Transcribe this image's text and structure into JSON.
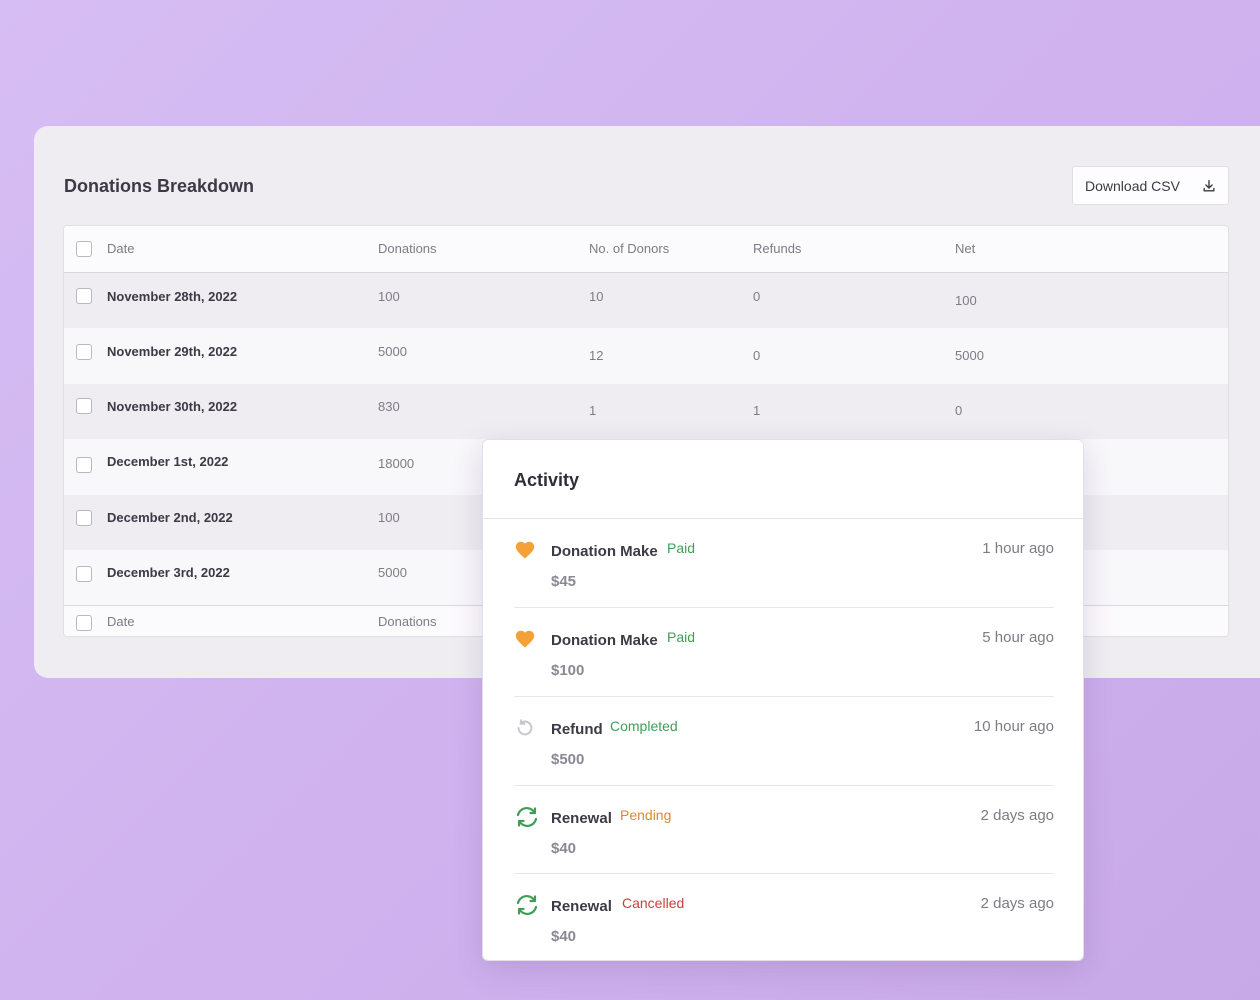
{
  "breakdown": {
    "title": "Donations Breakdown",
    "download_label": "Download CSV",
    "columns": [
      "Date",
      "Donations",
      "No. of Donors",
      "Refunds",
      "Net"
    ],
    "rows": [
      {
        "date": "November 28th, 2022",
        "donations": "100",
        "donors": "10",
        "refunds": "0",
        "net": "100"
      },
      {
        "date": "November 29th, 2022",
        "donations": "5000",
        "donors": "12",
        "refunds": "0",
        "net": "5000"
      },
      {
        "date": "November 30th, 2022",
        "donations": "830",
        "donors": "1",
        "refunds": "1",
        "net": "0"
      },
      {
        "date": "December 1st, 2022",
        "donations": "18000"
      },
      {
        "date": "December 2nd, 2022",
        "donations": "100"
      },
      {
        "date": "December 3rd, 2022",
        "donations": "5000"
      }
    ],
    "footer": {
      "date": "Date",
      "donations": "Donations"
    }
  },
  "activity": {
    "title": "Activity",
    "items": [
      {
        "icon": "heart-icon",
        "name": "Donation Make",
        "status": "Paid",
        "status_color": "#3f9e58",
        "amount": "$45",
        "time": "1 hour ago"
      },
      {
        "icon": "heart-icon",
        "name": "Donation Make",
        "status": "Paid",
        "status_color": "#3f9e58",
        "amount": "$100",
        "time": "5 hour ago"
      },
      {
        "icon": "refund-icon",
        "name": "Refund",
        "status": "Completed",
        "status_color": "#3f9e58",
        "amount": "$500",
        "time": "10 hour ago"
      },
      {
        "icon": "renewal-icon",
        "name": "Renewal",
        "status": "Pending",
        "status_color": "#d98b2b",
        "amount": "$40",
        "time": "2 days ago"
      },
      {
        "icon": "renewal-icon",
        "name": "Renewal",
        "status": "Cancelled",
        "status_color": "#c94040",
        "amount": "$40",
        "time": "2 days ago"
      }
    ]
  },
  "colors": {
    "heart": "#f5a13a",
    "renewal": "#3f9e58",
    "refund": "#c9c7cf"
  }
}
